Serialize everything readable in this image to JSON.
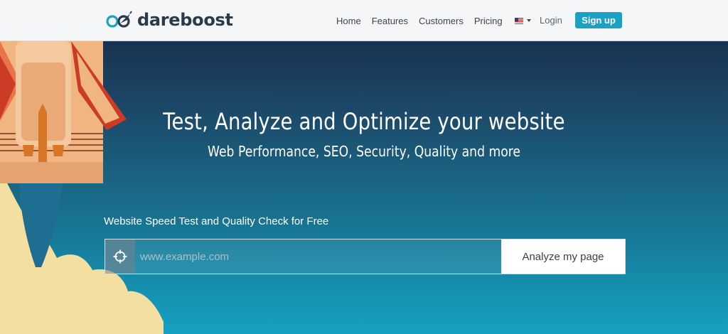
{
  "navbar": {
    "logo_text": "dareboost",
    "links": [
      "Home",
      "Features",
      "Customers",
      "Pricing"
    ],
    "language_icon": "us-flag-icon",
    "login_label": "Login",
    "signup_label": "Sign up"
  },
  "hero": {
    "title": "Test, Analyze and Optimize your website",
    "subtitle": "Web Performance, SEO, Security, Quality and more"
  },
  "speed_test": {
    "label": "Website Speed Test and Quality Check for Free",
    "url_placeholder": "www.example.com",
    "url_value": "",
    "button_label": "Analyze my page",
    "target_icon": "crosshair-icon"
  },
  "colors": {
    "brand_accent": "#19a2c6",
    "logo_dark": "#2b3a4a",
    "hero_top": "#1a3251",
    "hero_bottom": "#15a1c2"
  }
}
